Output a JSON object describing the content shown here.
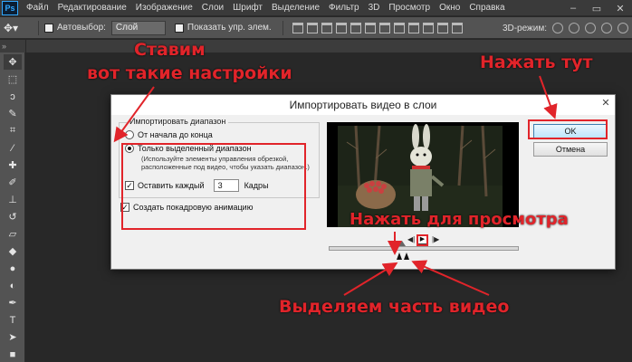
{
  "app": {
    "logo": "Ps",
    "menu": [
      "Файл",
      "Редактирование",
      "Изображение",
      "Слои",
      "Шрифт",
      "Выделение",
      "Фильтр",
      "3D",
      "Просмотр",
      "Окно",
      "Справка"
    ]
  },
  "options": {
    "auto_select_label": "Автовыбор:",
    "auto_select_value": "Слой",
    "show_transform_label": "Показать упр. элем.",
    "mode_3d_label": "3D-режим:"
  },
  "dialog": {
    "title": "Импортировать видео в слои",
    "group_label": "Импортировать диапазон",
    "radio_from_start": "От начала до конца",
    "radio_selected": "Только выделенный диапазон",
    "hint": "(Используйте элементы управления обрезкой, расположенные под видео, чтобы указать диапазон.)",
    "keep_every_label": "Оставить каждый",
    "keep_every_value": "3",
    "frames_label": "Кадры",
    "frame_anim_label": "Создать покадровую анимацию",
    "ok_label": "OK",
    "cancel_label": "Отмена"
  },
  "annotations": {
    "settings_line1": "Ставим",
    "settings_line2": "вот такие настройки",
    "click_here": "Нажать тут",
    "click_preview": "Нажать для просмотра",
    "select_part": "Выделяем часть видео"
  },
  "colors": {
    "annotation": "#e1242a",
    "photoshop_blue": "#31a8ff"
  }
}
